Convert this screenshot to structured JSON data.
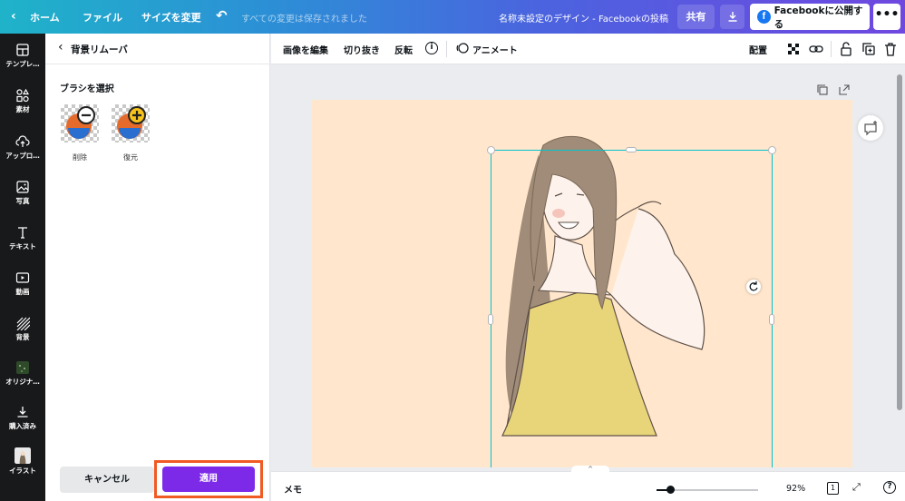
{
  "topbar": {
    "home": "ホーム",
    "file": "ファイル",
    "resize": "サイズを変更",
    "saved_status": "すべての変更は保存されました",
    "design_title": "名称未設定のデザイン - Facebookの投稿",
    "share": "共有",
    "publish": "Facebookに公開する",
    "more": "•••"
  },
  "rail": {
    "items": [
      {
        "label": "テンプレ…",
        "icon": "template-icon"
      },
      {
        "label": "素材",
        "icon": "elements-icon"
      },
      {
        "label": "アップロ…",
        "icon": "upload-icon"
      },
      {
        "label": "写真",
        "icon": "photo-icon"
      },
      {
        "label": "テキスト",
        "icon": "text-icon"
      },
      {
        "label": "動画",
        "icon": "video-icon"
      },
      {
        "label": "背景",
        "icon": "background-icon"
      },
      {
        "label": "オリジナ…",
        "icon": "original-icon"
      },
      {
        "label": "購入済み",
        "icon": "purchased-icon"
      },
      {
        "label": "イラスト",
        "icon": "illustration-icon"
      }
    ]
  },
  "panel": {
    "title": "背景リムーバ",
    "brush_heading": "ブラシを選択",
    "brush_erase": "削除",
    "brush_restore": "復元",
    "cancel": "キャンセル",
    "apply": "適用"
  },
  "toolbar": {
    "edit_image": "画像を編集",
    "crop": "切り抜き",
    "flip": "反転",
    "info": "i",
    "animate": "アニメート",
    "position": "配置"
  },
  "bottombar": {
    "memo": "メモ",
    "zoom": "92%",
    "zoom_level": 0.92,
    "page_count": "1",
    "help": "?"
  },
  "colors": {
    "accent": "#7d2ae8",
    "highlight": "#f05a23",
    "selection": "#00c4cc",
    "page_bg": "#ffe6cc"
  }
}
